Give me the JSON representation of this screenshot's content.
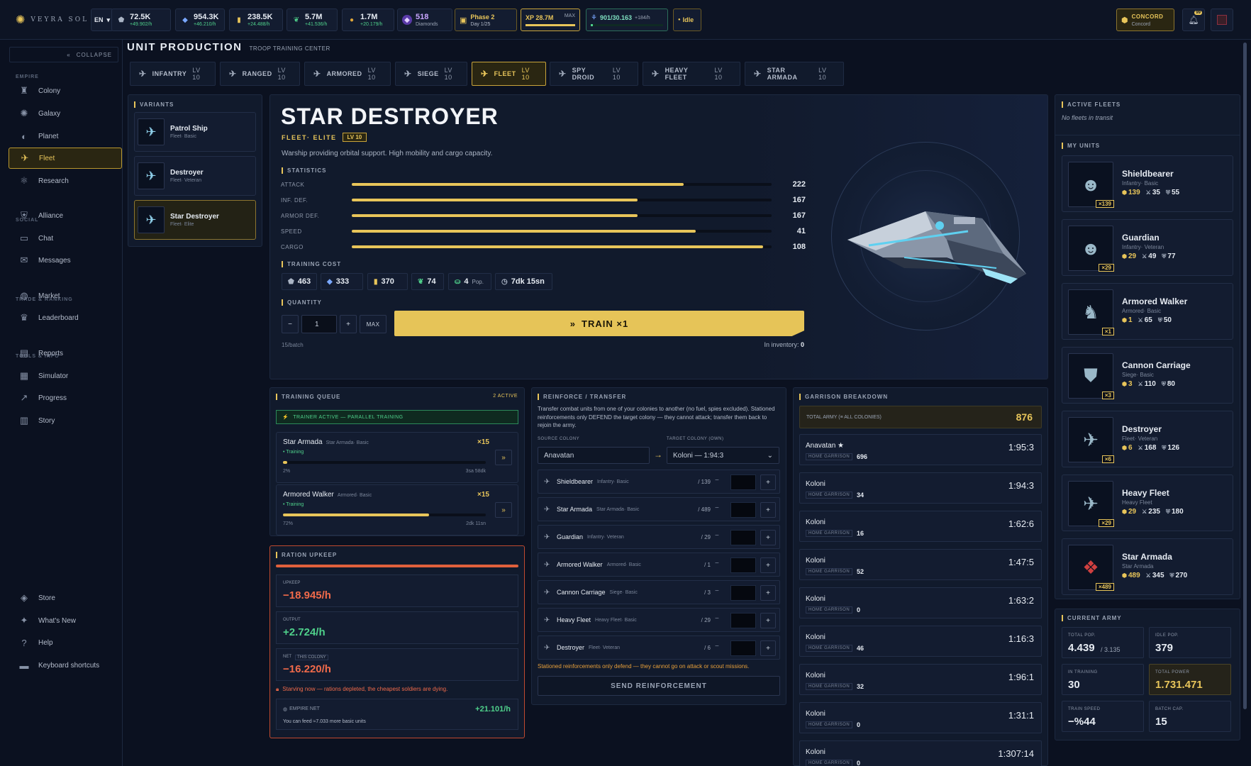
{
  "brand": "VEYRA SOL",
  "topbar": {
    "lang": "EN",
    "resources": [
      {
        "id": "metal",
        "value": "72.5K",
        "rate": "+49.902/h",
        "color": "#aab4c4",
        "icon": "ore-icon"
      },
      {
        "id": "crystal",
        "value": "954.3K",
        "rate": "+46.210/h",
        "color": "#7aa8ff",
        "icon": "crystal-icon"
      },
      {
        "id": "deuterium",
        "value": "238.5K",
        "rate": "+24.488/h",
        "color": "#e8c55a",
        "icon": "fuel-icon"
      },
      {
        "id": "food",
        "value": "5.7M",
        "rate": "+41.536/h",
        "color": "#4fd18b",
        "icon": "leaf-icon"
      },
      {
        "id": "gold",
        "value": "1.7M",
        "rate": "+20.179/h",
        "color": "#e0a63a",
        "icon": "coin-icon"
      }
    ],
    "diamonds": {
      "value": "518",
      "label": "Diamonds"
    },
    "phase": {
      "title": "Phase 2",
      "sub": "Day 1/25"
    },
    "xp": {
      "label": "XP 28.7M",
      "max": "MAX",
      "progress": 1.0
    },
    "population": {
      "value": "901/30.163",
      "rate": "+184/h",
      "progress": 0.03
    },
    "status": "Idle",
    "alliance": {
      "name": "CONCORD",
      "sub": "Concord"
    },
    "notification_count": "99"
  },
  "sidebar": {
    "collapse_label": "COLLAPSE",
    "sections": [
      {
        "title": "EMPIRE",
        "items": [
          {
            "label": "Colony",
            "icon": "castle-icon"
          },
          {
            "label": "Galaxy",
            "icon": "galaxy-icon"
          },
          {
            "label": "Planet",
            "icon": "planet-icon"
          },
          {
            "label": "Fleet",
            "icon": "fleet-icon",
            "active": true
          },
          {
            "label": "Research",
            "icon": "atom-icon"
          }
        ]
      },
      {
        "title": "SOCIAL",
        "items": [
          {
            "label": "Alliance",
            "icon": "shield-icon"
          },
          {
            "label": "Chat",
            "icon": "chat-icon"
          },
          {
            "label": "Messages",
            "icon": "mail-icon"
          }
        ]
      },
      {
        "title": "TRADE & RANKING",
        "items": [
          {
            "label": "Market",
            "icon": "globe-icon"
          },
          {
            "label": "Leaderboard",
            "icon": "trophy-icon"
          }
        ]
      },
      {
        "title": "TOOLS & INFO",
        "items": [
          {
            "label": "Reports",
            "icon": "document-icon"
          },
          {
            "label": "Simulator",
            "icon": "grid-icon"
          },
          {
            "label": "Progress",
            "icon": "progress-icon"
          },
          {
            "label": "Story",
            "icon": "book-icon"
          }
        ]
      }
    ],
    "bottom": [
      {
        "label": "Store",
        "icon": "store-icon"
      },
      {
        "label": "What's New",
        "icon": "sparkle-icon"
      },
      {
        "label": "Help",
        "icon": "help-icon"
      },
      {
        "label": "Keyboard shortcuts",
        "icon": "keyboard-icon"
      }
    ]
  },
  "header": {
    "title": "UNIT PRODUCTION",
    "subtitle": "TROOP TRAINING CENTER"
  },
  "tabs": [
    {
      "label": "INFANTRY",
      "lv": "LV 10"
    },
    {
      "label": "RANGED",
      "lv": "LV 10"
    },
    {
      "label": "ARMORED",
      "lv": "LV 10"
    },
    {
      "label": "SIEGE",
      "lv": "LV 10"
    },
    {
      "label": "FLEET",
      "lv": "LV 10",
      "active": true
    },
    {
      "label": "SPY DROID",
      "lv": "LV 10"
    },
    {
      "label": "HEAVY FLEET",
      "lv": "LV 10"
    },
    {
      "label": "STAR ARMADA",
      "lv": "LV 10"
    }
  ],
  "variants": {
    "title": "VARIANTS",
    "items": [
      {
        "name": "Patrol Ship",
        "sub": "Fleet· Basic"
      },
      {
        "name": "Destroyer",
        "sub": "Fleet· Veteran"
      },
      {
        "name": "Star Destroyer",
        "sub": "Fleet· Elite",
        "active": true
      }
    ]
  },
  "unit": {
    "name": "STAR DESTROYER",
    "tier": "FLEET· ELITE",
    "level": "LV 10",
    "description": "Warship providing orbital support. High mobility and cargo capacity.",
    "stats_title": "STATISTICS",
    "stats": [
      {
        "label": "ATTACK",
        "value": "222",
        "pct": 0.79
      },
      {
        "label": "INF. DEF.",
        "value": "167",
        "pct": 0.68
      },
      {
        "label": "ARMOR DEF.",
        "value": "167",
        "pct": 0.68
      },
      {
        "label": "SPEED",
        "value": "41",
        "pct": 0.82
      },
      {
        "label": "CARGO",
        "value": "108",
        "pct": 0.98
      }
    ],
    "cost_title": "TRAINING COST",
    "costs": [
      {
        "value": "463",
        "icon": "ore-icon",
        "color": "#aab4c4"
      },
      {
        "value": "333",
        "icon": "crystal-icon",
        "color": "#7aa8ff"
      },
      {
        "value": "370",
        "icon": "fuel-icon",
        "color": "#e8c55a"
      },
      {
        "value": "74",
        "icon": "leaf-icon",
        "color": "#4fd18b"
      },
      {
        "value": "4",
        "unit": "Pop.",
        "icon": "pop-icon",
        "color": "#4fd18b"
      },
      {
        "value": "7dk 15sn",
        "icon": "clock-icon",
        "color": "#aab4c4"
      }
    ],
    "quantity_title": "QUANTITY",
    "quantity": "1",
    "max_label": "MAX",
    "train_label": "TRAIN ×1",
    "batch": "15/batch",
    "inventory_label": "In inventory:",
    "inventory": "0"
  },
  "active_fleets": {
    "title": "ACTIVE FLEETS",
    "empty": "No fleets in transit"
  },
  "my_units": {
    "title": "MY UNITS",
    "items": [
      {
        "name": "Shieldbearer",
        "sub": "Infantry· Basic",
        "count": "×139",
        "a": "139",
        "b": "35",
        "c": "55",
        "icon": "soldier-icon"
      },
      {
        "name": "Guardian",
        "sub": "Infantry· Veteran",
        "count": "×29",
        "a": "29",
        "b": "49",
        "c": "77",
        "icon": "soldier-icon"
      },
      {
        "name": "Armored Walker",
        "sub": "Armored· Basic",
        "count": "×1",
        "a": "1",
        "b": "65",
        "c": "50",
        "icon": "walker-icon"
      },
      {
        "name": "Cannon Carriage",
        "sub": "Siege· Basic",
        "count": "×3",
        "a": "3",
        "b": "110",
        "c": "80",
        "icon": "shield-robot-icon"
      },
      {
        "name": "Destroyer",
        "sub": "Fleet· Veteran",
        "count": "×6",
        "a": "6",
        "b": "168",
        "c": "126",
        "icon": "ship-icon"
      },
      {
        "name": "Heavy Fleet",
        "sub": "Heavy Fleet",
        "count": "×29",
        "a": "29",
        "b": "235",
        "c": "180",
        "icon": "ship-icon"
      },
      {
        "name": "Star Armada",
        "sub": "Star Armada",
        "count": "×489",
        "a": "489",
        "b": "345",
        "c": "270",
        "icon": "armada-icon"
      }
    ]
  },
  "current_army": {
    "title": "CURRENT ARMY",
    "tiles": [
      {
        "label": "TOTAL POP.",
        "value": "4.439",
        "extra": "/ 3.135"
      },
      {
        "label": "IDLE POP.",
        "value": "379"
      },
      {
        "label": "IN TRAINING",
        "value": "30"
      },
      {
        "label": "TOTAL POWER",
        "value": "1.731.471",
        "highlight": true
      },
      {
        "label": "TRAIN SPEED",
        "value": "−%44"
      },
      {
        "label": "BATCH CAP.",
        "value": "15"
      }
    ]
  },
  "queue": {
    "title": "TRAINING QUEUE",
    "active": "2 ACTIVE",
    "banner": "TRAINER ACTIVE — PARALLEL TRAINING",
    "items": [
      {
        "name": "Star Armada",
        "sub": "Star Armada· Basic",
        "qty": "×15",
        "status": "Training",
        "pct": "2%",
        "progress": 0.02,
        "time": "3sa 58dk"
      },
      {
        "name": "Armored Walker",
        "sub": "Armored· Basic",
        "qty": "×15",
        "status": "Training",
        "pct": "72%",
        "progress": 0.72,
        "time": "2dk 11sn"
      }
    ]
  },
  "upkeep": {
    "title": "RATION UPKEEP",
    "upkeep_label": "UPKEEP",
    "upkeep": "−18.945/h",
    "output_label": "OUTPUT",
    "output": "+2.724/h",
    "net_label": "NET",
    "net_tag": "THIS COLONY",
    "net": "−16.220/h",
    "warning": "Starving now — rations depleted, the cheapest soldiers are dying.",
    "empire_label": "EMPIRE NET",
    "empire_net": "+21.101/h",
    "empire_note": "You can feed ≈7.033 more basic units"
  },
  "transfer": {
    "title": "REINFORCE / TRANSFER",
    "desc": "Transfer combat units from one of your colonies to another (no fuel, spies excluded). Stationed reinforcements only DEFEND the target colony — they cannot attack; transfer them back to rejoin the army.",
    "source_label": "SOURCE COLONY",
    "source": "Anavatan",
    "target_label": "TARGET COLONY (OWN)",
    "target": "Koloni — 1:94:3",
    "rows": [
      {
        "name": "Shieldbearer",
        "sub": "Infantry· Basic",
        "max": "/ 139"
      },
      {
        "name": "Star Armada",
        "sub": "Star Armada· Basic",
        "max": "/ 489"
      },
      {
        "name": "Guardian",
        "sub": "Infantry· Veteran",
        "max": "/ 29"
      },
      {
        "name": "Armored Walker",
        "sub": "Armored· Basic",
        "max": "/ 1"
      },
      {
        "name": "Cannon Carriage",
        "sub": "Siege· Basic",
        "max": "/ 3"
      },
      {
        "name": "Heavy Fleet",
        "sub": "Heavy Fleet· Basic",
        "max": "/ 29"
      },
      {
        "name": "Destroyer",
        "sub": "Fleet· Veteran",
        "max": "/ 6"
      }
    ],
    "note": "Stationed reinforcements only defend — they cannot go on attack or scout missions.",
    "send_label": "SEND REINFORCEMENT"
  },
  "garrison": {
    "title": "GARRISON BREAKDOWN",
    "total_label": "TOTAL ARMY (≡ ALL COLONIES)",
    "total": "876",
    "tag": "HOME GARRISON",
    "rows": [
      {
        "name": "Anavatan ★",
        "count": "696",
        "coord": "1:95:3"
      },
      {
        "name": "Koloni",
        "count": "34",
        "coord": "1:94:3"
      },
      {
        "name": "Koloni",
        "count": "16",
        "coord": "1:62:6"
      },
      {
        "name": "Koloni",
        "count": "52",
        "coord": "1:47:5"
      },
      {
        "name": "Koloni",
        "count": "0",
        "coord": "1:63:2"
      },
      {
        "name": "Koloni",
        "count": "46",
        "coord": "1:16:3"
      },
      {
        "name": "Koloni",
        "count": "32",
        "coord": "1:96:1"
      },
      {
        "name": "Koloni",
        "count": "0",
        "coord": "1:31:1"
      },
      {
        "name": "Koloni",
        "count": "0",
        "coord": "1:307:14"
      }
    ]
  }
}
